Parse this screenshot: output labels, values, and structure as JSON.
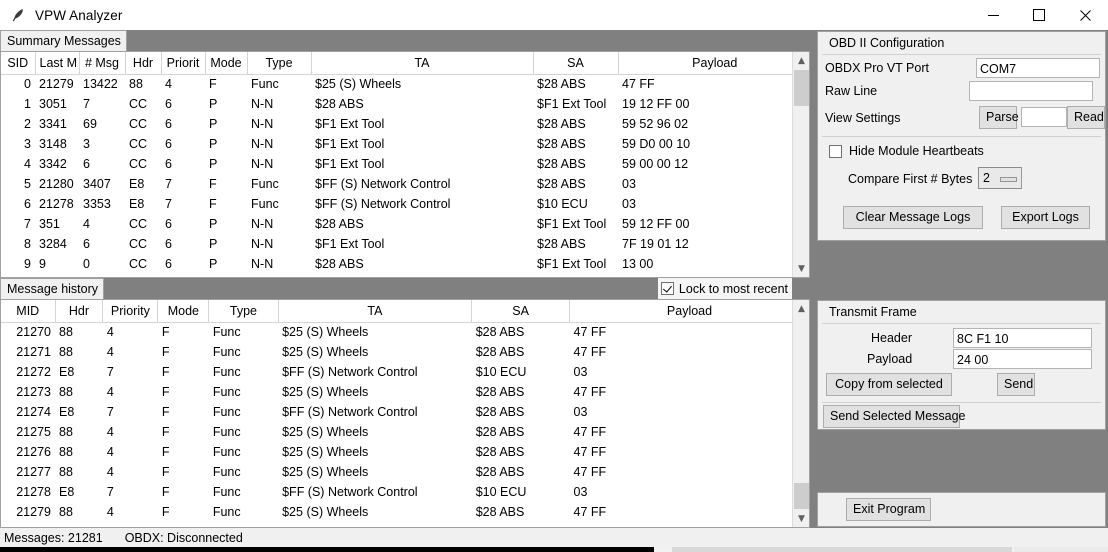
{
  "window": {
    "title": "VPW Analyzer",
    "icon": "feather-icon",
    "controls": {
      "minimize": "minimize-icon",
      "maximize": "maximize-icon",
      "close": "close-icon"
    }
  },
  "summary_panel": {
    "tab_label": "Summary Messages",
    "columns": [
      "SID",
      "Last M",
      "# Msg",
      "Hdr",
      "Priorit",
      "Mode",
      "Type",
      "TA",
      "SA",
      "Payload"
    ],
    "rows": [
      {
        "sid": "0",
        "last": "21279",
        "msgs": "13422",
        "hdr": "88",
        "priority": "4",
        "mode": "F",
        "type": "Func",
        "ta": "$25 (S) Wheels",
        "sa": "$28 ABS",
        "payload": "47 FF"
      },
      {
        "sid": "1",
        "last": "3051",
        "msgs": "7",
        "hdr": "CC",
        "priority": "6",
        "mode": "P",
        "type": "N-N",
        "ta": "$28 ABS",
        "sa": "$F1 Ext Tool",
        "payload": "19 12 FF 00"
      },
      {
        "sid": "2",
        "last": "3341",
        "msgs": "69",
        "hdr": "CC",
        "priority": "6",
        "mode": "P",
        "type": "N-N",
        "ta": "$F1 Ext Tool",
        "sa": "$28 ABS",
        "payload": "59 52 96 02"
      },
      {
        "sid": "3",
        "last": "3148",
        "msgs": "3",
        "hdr": "CC",
        "priority": "6",
        "mode": "P",
        "type": "N-N",
        "ta": "$F1 Ext Tool",
        "sa": "$28 ABS",
        "payload": "59 D0 00 10"
      },
      {
        "sid": "4",
        "last": "3342",
        "msgs": "6",
        "hdr": "CC",
        "priority": "6",
        "mode": "P",
        "type": "N-N",
        "ta": "$F1 Ext Tool",
        "sa": "$28 ABS",
        "payload": "59 00 00 12"
      },
      {
        "sid": "5",
        "last": "21280",
        "msgs": "3407",
        "hdr": "E8",
        "priority": "7",
        "mode": "F",
        "type": "Func",
        "ta": "$FF (S) Network Control",
        "sa": "$28 ABS",
        "payload": "03"
      },
      {
        "sid": "6",
        "last": "21278",
        "msgs": "3353",
        "hdr": "E8",
        "priority": "7",
        "mode": "F",
        "type": "Func",
        "ta": "$FF (S) Network Control",
        "sa": "$10 ECU",
        "payload": "03"
      },
      {
        "sid": "7",
        "last": "351",
        "msgs": "4",
        "hdr": "CC",
        "priority": "6",
        "mode": "P",
        "type": "N-N",
        "ta": "$28 ABS",
        "sa": "$F1 Ext Tool",
        "payload": "59 12 FF 00"
      },
      {
        "sid": "8",
        "last": "3284",
        "msgs": "6",
        "hdr": "CC",
        "priority": "6",
        "mode": "P",
        "type": "N-N",
        "ta": "$F1 Ext Tool",
        "sa": "$28 ABS",
        "payload": "7F 19 01 12"
      },
      {
        "sid": "9",
        "last": "9",
        "msgs": "0",
        "hdr": "CC",
        "priority": "6",
        "mode": "P",
        "type": "N-N",
        "ta": "$28 ABS",
        "sa": "$F1 Ext Tool",
        "payload": "13 00"
      }
    ]
  },
  "lock_to_recent": {
    "label": "Lock to most recent",
    "checked": true
  },
  "history_panel": {
    "tab_label": "Message history",
    "columns": [
      "MID",
      "Hdr",
      "Priority",
      "Mode",
      "Type",
      "TA",
      "SA",
      "Payload"
    ],
    "rows": [
      {
        "mid": "21270",
        "hdr": "88",
        "priority": "4",
        "mode": "F",
        "type": "Func",
        "ta": "$25 (S) Wheels",
        "sa": "$28 ABS",
        "payload": "47 FF"
      },
      {
        "mid": "21271",
        "hdr": "88",
        "priority": "4",
        "mode": "F",
        "type": "Func",
        "ta": "$25 (S) Wheels",
        "sa": "$28 ABS",
        "payload": "47 FF"
      },
      {
        "mid": "21272",
        "hdr": "E8",
        "priority": "7",
        "mode": "F",
        "type": "Func",
        "ta": "$FF (S) Network Control",
        "sa": "$10 ECU",
        "payload": "03"
      },
      {
        "mid": "21273",
        "hdr": "88",
        "priority": "4",
        "mode": "F",
        "type": "Func",
        "ta": "$25 (S) Wheels",
        "sa": "$28 ABS",
        "payload": "47 FF"
      },
      {
        "mid": "21274",
        "hdr": "E8",
        "priority": "7",
        "mode": "F",
        "type": "Func",
        "ta": "$FF (S) Network Control",
        "sa": "$28 ABS",
        "payload": "03"
      },
      {
        "mid": "21275",
        "hdr": "88",
        "priority": "4",
        "mode": "F",
        "type": "Func",
        "ta": "$25 (S) Wheels",
        "sa": "$28 ABS",
        "payload": "47 FF"
      },
      {
        "mid": "21276",
        "hdr": "88",
        "priority": "4",
        "mode": "F",
        "type": "Func",
        "ta": "$25 (S) Wheels",
        "sa": "$28 ABS",
        "payload": "47 FF"
      },
      {
        "mid": "21277",
        "hdr": "88",
        "priority": "4",
        "mode": "F",
        "type": "Func",
        "ta": "$25 (S) Wheels",
        "sa": "$28 ABS",
        "payload": "47 FF"
      },
      {
        "mid": "21278",
        "hdr": "E8",
        "priority": "7",
        "mode": "F",
        "type": "Func",
        "ta": "$FF (S) Network Control",
        "sa": "$10 ECU",
        "payload": "03"
      },
      {
        "mid": "21279",
        "hdr": "88",
        "priority": "4",
        "mode": "F",
        "type": "Func",
        "ta": "$25 (S) Wheels",
        "sa": "$28 ABS",
        "payload": "47 FF"
      }
    ]
  },
  "obd_config": {
    "title": "OBD II Configuration",
    "port_label": "OBDX Pro VT Port",
    "port_value": "COM7",
    "raw_line_label": "Raw Line",
    "raw_line_value": "",
    "view_settings_label": "View Settings",
    "parse_button": "Parse",
    "view_settings_value": "",
    "read_button": "Read",
    "hide_heartbeats_label": "Hide Module Heartbeats",
    "hide_heartbeats_checked": false,
    "compare_bytes_label": "Compare First # Bytes",
    "compare_bytes_value": "2",
    "clear_logs_button": "Clear Message Logs",
    "export_logs_button": "Export Logs"
  },
  "transmit_frame": {
    "title": "Transmit Frame",
    "header_label": "Header",
    "header_value": "8C F1 10",
    "payload_label": "Payload",
    "payload_value": "24 00",
    "copy_button": "Copy from selected",
    "send_button": "Send",
    "send_selected_button": "Send Selected Message"
  },
  "exit_panel": {
    "exit_button": "Exit Program"
  },
  "statusbar": {
    "messages": "Messages: 21281",
    "connection": "OBDX: Disconnected"
  }
}
